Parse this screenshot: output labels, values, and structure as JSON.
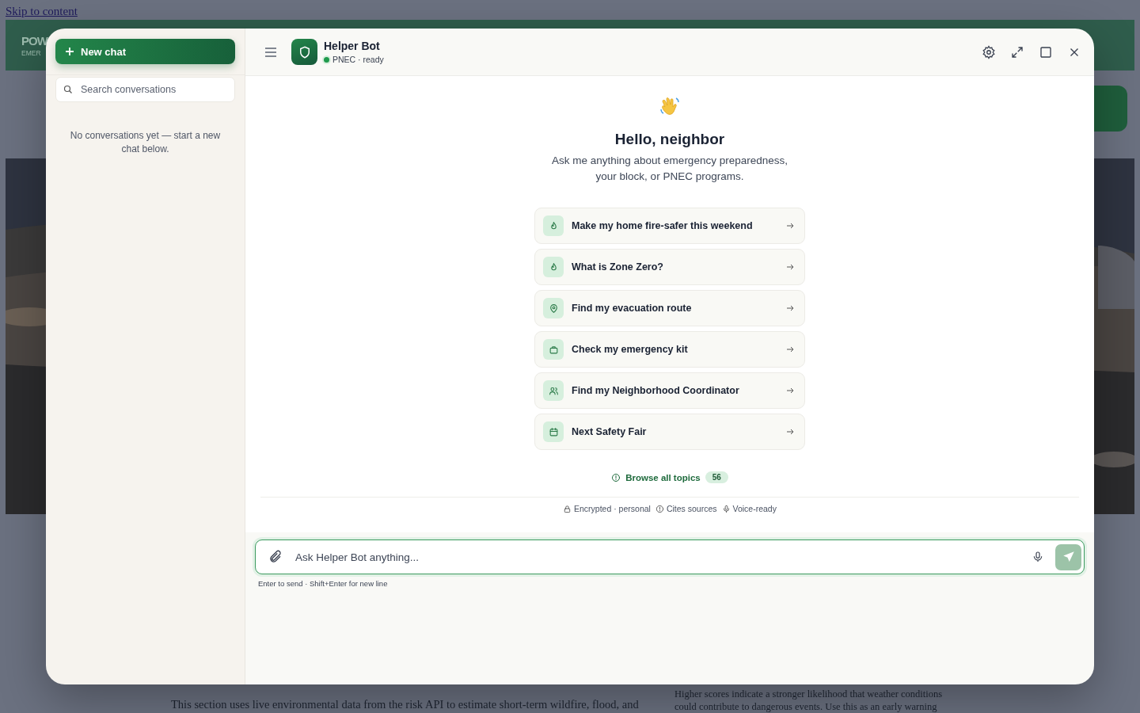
{
  "background_page": {
    "skip_link": "Skip to content",
    "logo_lines": [
      "POW",
      "EMER"
    ],
    "section_text": "This section uses live environmental data from the risk API to estimate short-term wildfire, flood, and",
    "side_text": [
      "Higher scores indicate a stronger likelihood that weather conditions",
      "could contribute to dangerous events. Use this as an early warning"
    ]
  },
  "sidebar": {
    "new_chat": "New chat",
    "search": {
      "placeholder": "Search conversations"
    },
    "empty_message": "No conversations yet — start a new chat below."
  },
  "header": {
    "title": "Helper Bot",
    "status": "PNEC · ready",
    "online": true
  },
  "welcome": {
    "title": "Hello, neighbor",
    "subtitle": "Ask me anything about emergency preparedness, your block, or PNEC programs."
  },
  "suggestions": [
    {
      "kind": "flame",
      "label": "Make my home fire-safer this weekend"
    },
    {
      "kind": "flame",
      "label": "What is Zone Zero?"
    },
    {
      "kind": "pin",
      "label": "Find my evacuation route"
    },
    {
      "kind": "bag",
      "label": "Check my emergency kit"
    },
    {
      "kind": "people",
      "label": "Find my Neighborhood Coordinator"
    },
    {
      "kind": "calendar",
      "label": "Next Safety Fair"
    }
  ],
  "browse": {
    "label": "Browse all topics",
    "count": "56"
  },
  "features": [
    {
      "kind": "lock",
      "label": "Encrypted · personal"
    },
    {
      "kind": "info",
      "label": "Cites sources"
    },
    {
      "kind": "mic",
      "label": "Voice-ready"
    }
  ],
  "composer": {
    "placeholder": "Ask Helper Bot anything...",
    "hint": "Enter to send · Shift+Enter for new line",
    "send_disabled": true
  }
}
